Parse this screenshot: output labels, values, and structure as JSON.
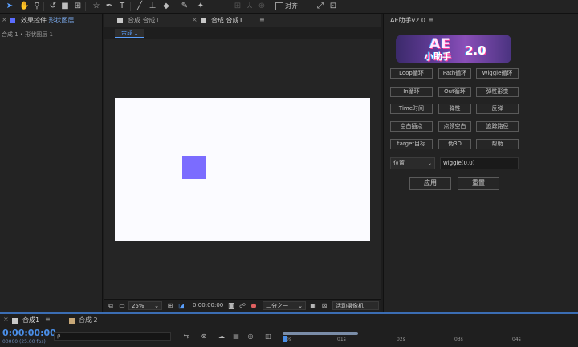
{
  "toolbar": {
    "snap_label": "对齐",
    "tools": [
      "selection-tool-icon",
      "hand-tool-icon",
      "zoom-tool-icon",
      "rotate-tool-icon",
      "camera-tool-icon",
      "pan-behind-tool-icon",
      "pen-tool-icon",
      "type-tool-icon",
      "brush-tool-icon",
      "clone-stamp-tool-icon",
      "eraser-tool-icon",
      "roto-brush-tool-icon",
      "puppet-pin-tool-icon"
    ]
  },
  "left_panel": {
    "title_prefix": "效果控件",
    "title_highlight": "形状图层",
    "path": "合成 1 • 形状图层 1"
  },
  "comp_panel": {
    "tab_inactive": "合成 合成1",
    "tab_active": "合成 合成1",
    "sub_tab": "合成 1",
    "footer": {
      "zoom": "25%",
      "timecode": "0:00:00:00",
      "resolution": "二分之一",
      "camera": "活动摄像机"
    },
    "layer_color": "#7b6cff"
  },
  "helper_panel": {
    "title": "AE助手v2.0",
    "logo": {
      "line1": "AE",
      "line2": "小助手",
      "line3": "2.0"
    },
    "buttons": [
      [
        "Loop循环",
        "Path循环",
        "Wiggle循环"
      ],
      [
        "In循环",
        "Out循环",
        "弹性形变"
      ],
      [
        "Time时间",
        "弹性",
        "反弹"
      ],
      [
        "空白插点",
        "点领空白",
        "追踪路径"
      ],
      [
        "target目标",
        "伪3D",
        "帮助"
      ]
    ],
    "property_select": "位置",
    "expression_input": "wiggle(0,0)",
    "apply_label": "应用",
    "reset_label": "重置"
  },
  "timeline": {
    "tab1": "合成1",
    "tab2": "合成 2",
    "timecode": "0:00:00:00",
    "timecode_sub": "00000 (25.00 fps)",
    "search_placeholder": "ρ",
    "ruler_ticks": [
      "0s",
      "01s",
      "02s",
      "03s",
      "04s"
    ]
  }
}
